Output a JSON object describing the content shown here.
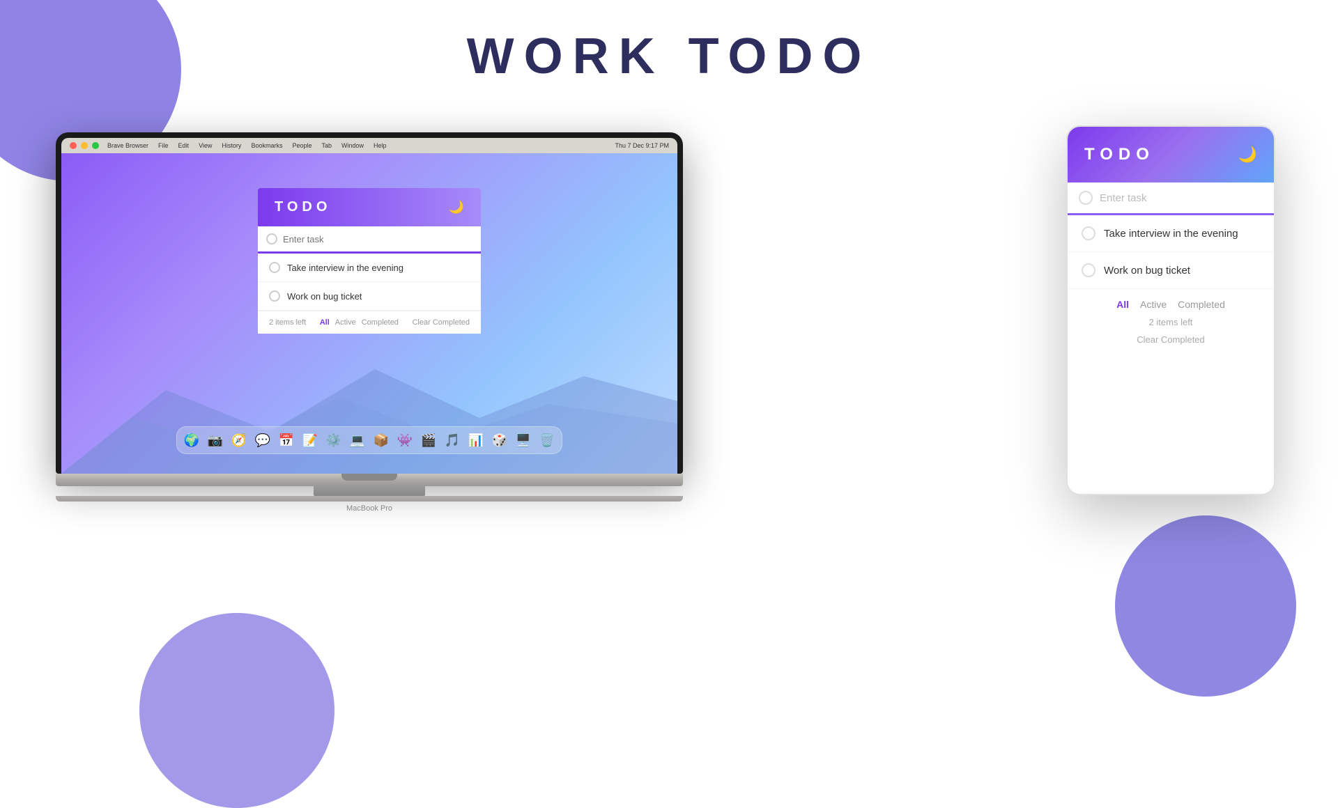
{
  "page": {
    "title": "WORK TODO",
    "bg_color": "#ffffff"
  },
  "header": {
    "title": "WORK TODO"
  },
  "macbook": {
    "label": "MacBook Pro",
    "menubar": {
      "app": "Brave Browser",
      "items": [
        "File",
        "Edit",
        "View",
        "History",
        "Bookmarks",
        "People",
        "Tab",
        "Window",
        "Help"
      ],
      "datetime": "Thu 7 Dec  9:17 PM"
    },
    "app": {
      "title": "TODO",
      "moon_icon": "🌙",
      "input_placeholder": "Enter task",
      "tasks": [
        {
          "text": "Take interview in the evening",
          "done": false
        },
        {
          "text": "Work on bug ticket",
          "done": false
        }
      ],
      "footer": {
        "items_left": "2 items left",
        "filters": [
          "All",
          "Active",
          "Completed"
        ],
        "active_filter": "All",
        "clear_label": "Clear Completed"
      }
    }
  },
  "phone": {
    "app": {
      "title": "TODO",
      "moon_icon": "🌙",
      "input_placeholder": "Enter task",
      "tasks": [
        {
          "text": "Take interview in the evening",
          "done": false
        },
        {
          "text": "Work on bug ticket",
          "done": false
        }
      ],
      "footer": {
        "items_left": "2 items left",
        "filters": [
          "All",
          "Active",
          "Completed"
        ],
        "active_filter": "All",
        "clear_label": "Clear Completed"
      }
    }
  },
  "colors": {
    "accent_purple": "#7c3aed",
    "light_purple": "#a78bfa",
    "blue": "#60a5fa",
    "title_dark": "#2d2d5e"
  },
  "dock_icons": [
    "🌍",
    "📷",
    "🧭",
    "💬",
    "📅",
    "📝",
    "⚙️",
    "💻",
    "📦",
    "👾",
    "🎬",
    "🎵",
    "📊",
    "🎲",
    "🖥️",
    "🗑️"
  ]
}
